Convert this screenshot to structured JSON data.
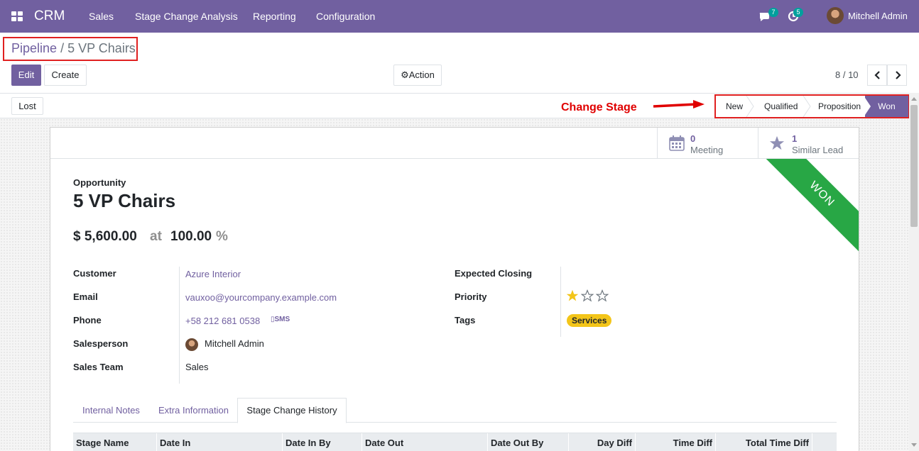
{
  "navbar": {
    "brand": "CRM",
    "menu": [
      "Sales",
      "Stage Change Analysis",
      "Reporting",
      "Configuration"
    ],
    "messages_badge": "7",
    "activities_badge": "5",
    "user_name": "Mitchell Admin"
  },
  "breadcrumb": {
    "parent": "Pipeline",
    "separator": "/",
    "current": "5 VP Chairs"
  },
  "toolbar": {
    "edit_label": "Edit",
    "create_label": "Create",
    "action_label": "Action",
    "pager": "8 / 10"
  },
  "statusbar": {
    "lost_label": "Lost",
    "annotation": "Change Stage",
    "stages": [
      "New",
      "Qualified",
      "Proposition",
      "Won"
    ],
    "active_stage": "Won"
  },
  "stat_buttons": {
    "meeting_count": "0",
    "meeting_label": "Meeting",
    "similar_count": "1",
    "similar_label": "Similar Lead"
  },
  "ribbon": "WON",
  "form": {
    "type_label": "Opportunity",
    "name": "5 VP Chairs",
    "revenue": "$ 5,600.00",
    "at": "at",
    "probability": "100.00",
    "pct": "%",
    "fields_left": {
      "customer_label": "Customer",
      "customer": "Azure Interior",
      "email_label": "Email",
      "email": "vauxoo@yourcompany.example.com",
      "phone_label": "Phone",
      "phone": "+58 212 681 0538",
      "sms": "SMS",
      "salesperson_label": "Salesperson",
      "salesperson": "Mitchell Admin",
      "team_label": "Sales Team",
      "team": "Sales"
    },
    "fields_right": {
      "closing_label": "Expected Closing",
      "priority_label": "Priority",
      "priority_value": 1,
      "priority_max": 3,
      "tags_label": "Tags",
      "tag": "Services"
    }
  },
  "tabs": [
    "Internal Notes",
    "Extra Information",
    "Stage Change History"
  ],
  "table_headers": [
    "Stage Name",
    "Date In",
    "Date In By",
    "Date Out",
    "Date Out By",
    "Day Diff",
    "Time Diff",
    "Total Time Diff"
  ],
  "colors": {
    "brand": "#7160a0",
    "won_ribbon": "#28a745",
    "annotation": "#e00000",
    "tag": "#f3c519"
  }
}
